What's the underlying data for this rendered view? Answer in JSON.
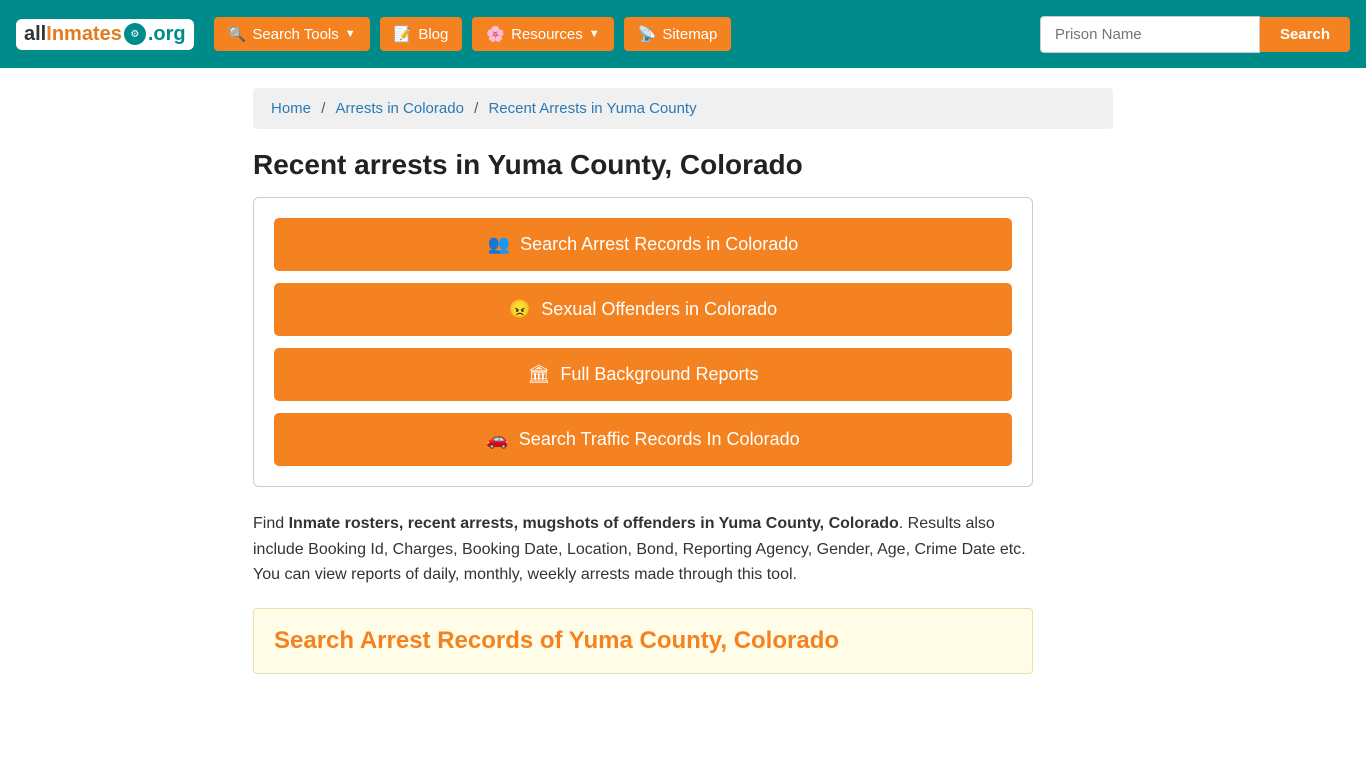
{
  "navbar": {
    "logo": {
      "text_all": "all",
      "text_inmates": "Inmates",
      "text_org": ".org"
    },
    "buttons": [
      {
        "label": "Search Tools",
        "icon": "🔍",
        "has_dropdown": true
      },
      {
        "label": "Blog",
        "icon": "📝",
        "has_dropdown": false
      },
      {
        "label": "Resources",
        "icon": "🌸",
        "has_dropdown": true
      },
      {
        "label": "Sitemap",
        "icon": "📡",
        "has_dropdown": false
      }
    ],
    "search": {
      "placeholder": "Prison Name",
      "button_label": "Search"
    }
  },
  "breadcrumb": {
    "items": [
      {
        "label": "Home",
        "href": "/"
      },
      {
        "label": "Arrests in Colorado",
        "href": "/arrests-in-colorado"
      },
      {
        "label": "Recent Arrests in Yuma County",
        "href": "#"
      }
    ]
  },
  "page": {
    "title": "Recent arrests in Yuma County, Colorado",
    "action_buttons": [
      {
        "icon": "👥",
        "label": "Search Arrest Records in Colorado"
      },
      {
        "icon": "😠",
        "label": "Sexual Offenders in Colorado"
      },
      {
        "icon": "🏛",
        "label": "Full Background Reports"
      },
      {
        "icon": "🚗",
        "label": "Search Traffic Records In Colorado"
      }
    ],
    "description_prefix": "Find ",
    "description_bold": "Inmate rosters, recent arrests, mugshots of offenders in Yuma County, Colorado",
    "description_suffix": ". Results also include Booking Id, Charges, Booking Date, Location, Bond, Reporting Agency, Gender, Age, Crime Date etc. You can view reports of daily, monthly, weekly arrests made through this tool.",
    "search_section_title": "Search Arrest Records of Yuma County, Colorado"
  }
}
